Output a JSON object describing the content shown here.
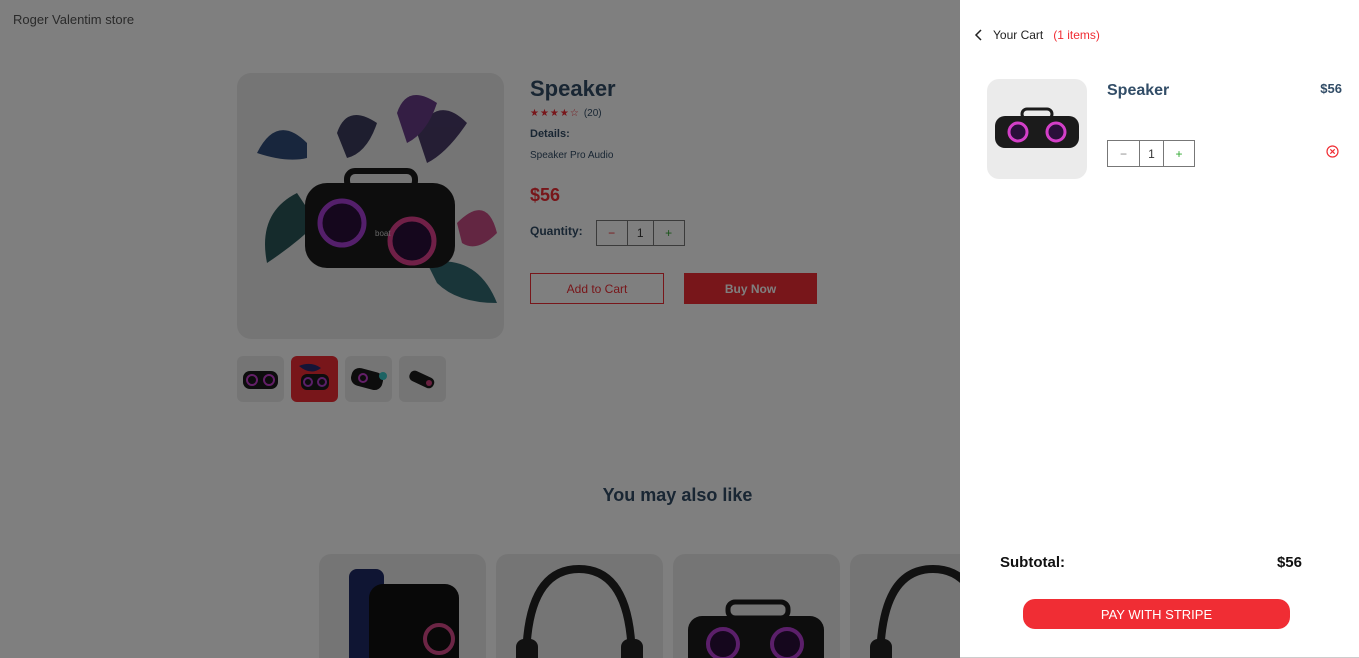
{
  "store": {
    "brand": "Roger Valentim store"
  },
  "product": {
    "title": "Speaker",
    "rating_stars": "★★★★☆",
    "rating_value": 4,
    "review_count": "(20)",
    "details_heading": "Details:",
    "details_text": "Speaker Pro Audio",
    "price": "$56",
    "quantity_label": "Quantity:",
    "quantity": "1",
    "minus": "−",
    "plus": "+",
    "add_to_cart": "Add to Cart",
    "buy_now": "Buy Now",
    "thumbnails": [
      "speaker-front",
      "speaker-leaves",
      "speaker-side",
      "speaker-small"
    ]
  },
  "suggestions": {
    "heading": "You may also like",
    "items": [
      "smartwatch",
      "headphones",
      "speaker",
      "headphones"
    ]
  },
  "cart": {
    "heading": "Your Cart",
    "count": "(1 items)",
    "items": [
      {
        "name": "Speaker",
        "price": "$56",
        "quantity": "1",
        "minus": "−",
        "plus": "+"
      }
    ],
    "subtotal_label": "Subtotal:",
    "subtotal_value": "$56",
    "pay_button": "PAY WITH STRIPE"
  },
  "colors": {
    "accent": "#f02d34",
    "text": "#324d67",
    "plus": "#31a831",
    "image_bg": "#ebebeb"
  }
}
